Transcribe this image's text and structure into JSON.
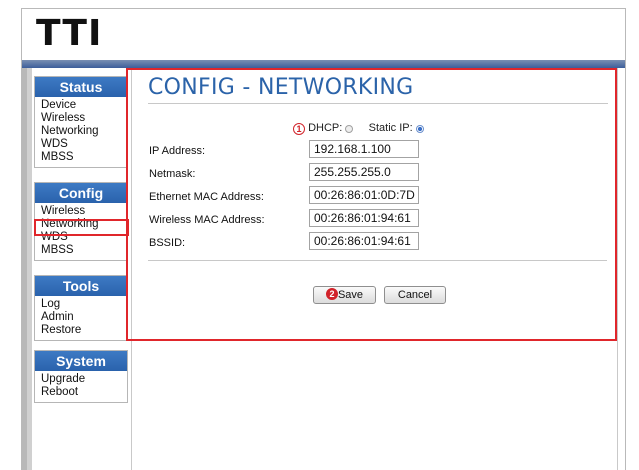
{
  "logo": "TTI",
  "nav": [
    {
      "title": "Status",
      "items": [
        "Device",
        "Wireless",
        "Networking",
        "WDS",
        "MBSS"
      ]
    },
    {
      "title": "Config",
      "items": [
        "Wireless",
        "Networking",
        "WDS",
        "MBSS"
      ]
    },
    {
      "title": "Tools",
      "items": [
        "Log",
        "Admin",
        "Restore"
      ]
    },
    {
      "title": "System",
      "items": [
        "Upgrade",
        "Reboot"
      ]
    }
  ],
  "page": {
    "title": "CONFIG - NETWORKING",
    "marker_1": "1",
    "marker_2": "2",
    "dhcp_label": "DHCP:",
    "static_label": "Static IP:",
    "mode_selected": "static",
    "fields": [
      {
        "label": "IP Address:",
        "value": "192.168.1.100"
      },
      {
        "label": "Netmask:",
        "value": "255.255.255.0"
      },
      {
        "label": "Ethernet MAC Address:",
        "value": "00:26:86:01:0D:7D"
      },
      {
        "label": "Wireless MAC Address:",
        "value": "00:26:86:01:94:61"
      },
      {
        "label": "BSSID:",
        "value": "00:26:86:01:94:61"
      }
    ],
    "save_label": "Save",
    "cancel_label": "Cancel"
  },
  "colors": {
    "accent": "#2b63a9",
    "nav_header": "#2a62ac",
    "highlight": "#e0262b"
  }
}
